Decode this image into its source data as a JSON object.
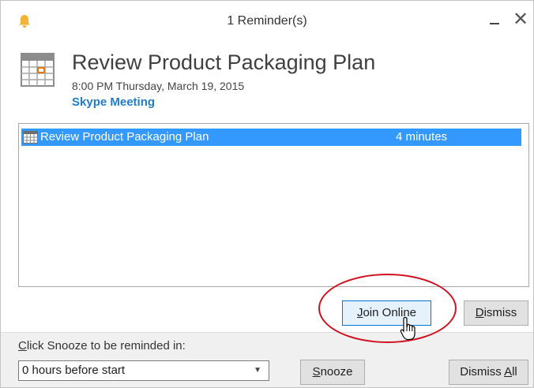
{
  "window": {
    "title": "1 Reminder(s)",
    "close_glyph": "✕"
  },
  "icons": {
    "title_icon": "bell-icon",
    "header_icon": "calendar-icon",
    "row_icon": "calendar-icon",
    "cursor": "mouse-pointer-icon"
  },
  "reminder": {
    "subject": "Review Product Packaging Plan",
    "datetime": "8:00 PM Thursday, March 19, 2015",
    "location": "Skype Meeting"
  },
  "list": {
    "items": [
      {
        "subject": "Review Product Packaging Plan",
        "due_in": "4 minutes",
        "selected": true
      }
    ]
  },
  "buttons": {
    "join_online": {
      "prefix": "",
      "access_key": "J",
      "rest": "oin Online"
    },
    "dismiss": {
      "prefix": "",
      "access_key": "D",
      "rest": "ismiss"
    },
    "snooze": {
      "prefix": "",
      "access_key": "S",
      "rest": "nooze"
    },
    "dismiss_all": {
      "prefix": "Dismiss ",
      "access_key": "A",
      "rest": "ll"
    }
  },
  "snooze": {
    "label_access_key": "C",
    "label_rest": "lick Snooze to be reminded in:",
    "selected_option": "0 hours before start"
  },
  "colors": {
    "selection": "#3399ff",
    "location_link": "#1f7ccd",
    "highlight_oval": "#d10f1d",
    "bell": "#f5b335"
  }
}
